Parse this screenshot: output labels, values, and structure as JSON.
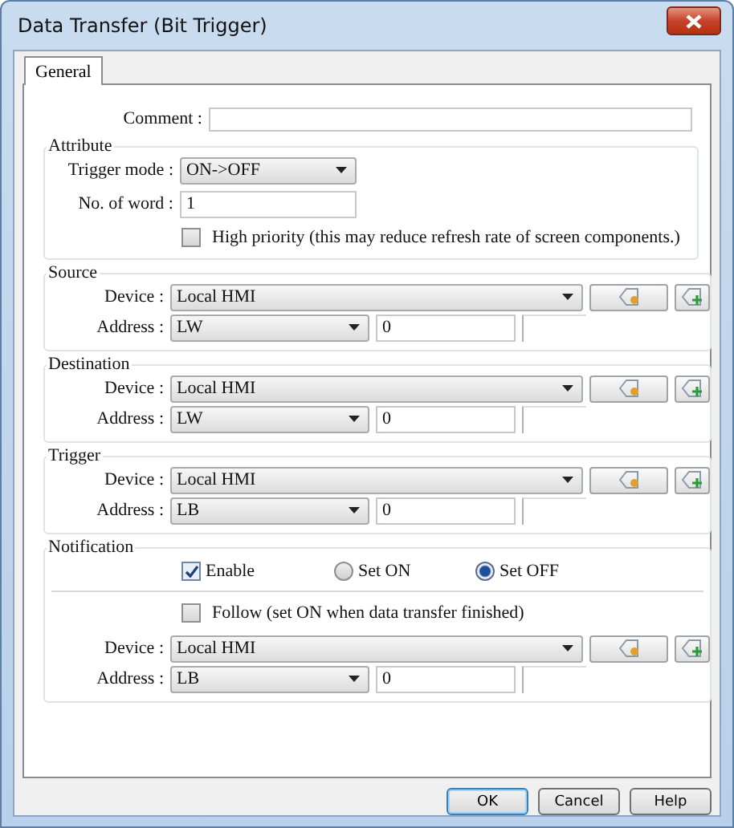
{
  "window": {
    "title": "Data Transfer (Bit Trigger)"
  },
  "tabs": [
    {
      "label": "General",
      "selected": true
    }
  ],
  "comment": {
    "label": "Comment :"
  },
  "attribute": {
    "title": "Attribute",
    "trigger_mode": {
      "label": "Trigger mode :",
      "value": "ON->OFF"
    },
    "word_count": {
      "label": "No. of word :",
      "value": "1"
    },
    "high_priority": {
      "label": "High priority (this may reduce refresh rate of screen components.)",
      "checked": false
    }
  },
  "device_groups": [
    {
      "title": "Source",
      "device_label": "Device :",
      "device": "Local HMI",
      "address_label": "Address :",
      "address_type": "LW",
      "address": "0"
    },
    {
      "title": "Destination",
      "device_label": "Device :",
      "device": "Local HMI",
      "address_label": "Address :",
      "address_type": "LW",
      "address": "0"
    },
    {
      "title": "Trigger",
      "device_label": "Device :",
      "device": "Local HMI",
      "address_label": "Address :",
      "address_type": "LB",
      "address": "0"
    }
  ],
  "notification": {
    "title": "Notification",
    "enable": {
      "label": "Enable",
      "checked": true
    },
    "options": [
      {
        "label": "Set ON",
        "selected": false
      },
      {
        "label": "Set OFF",
        "selected": true
      }
    ],
    "follow": {
      "label": "Follow (set ON when data transfer finished)",
      "checked": false
    },
    "device_label": "Device :",
    "device": "Local HMI",
    "address_label": "Address :",
    "address_type": "LB",
    "address": "0"
  },
  "buttons": [
    {
      "label": "OK",
      "default": true
    },
    {
      "label": "Cancel",
      "default": false
    },
    {
      "label": "Help",
      "default": false
    }
  ]
}
